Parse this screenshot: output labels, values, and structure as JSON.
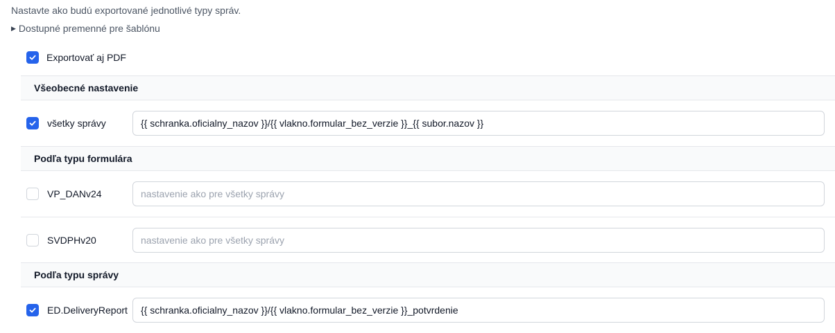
{
  "intro_text": "Nastavte ako budú exportované jednotlivé typy správ.",
  "details_label": "Dostupné premenné pre šablónu",
  "export_pdf": {
    "label": "Exportovať aj PDF",
    "checked": true
  },
  "sections": [
    {
      "title": "Všeobecné nastavenie",
      "rows": [
        {
          "label": "všetky správy",
          "checked": true,
          "value": "{{ schranka.oficialny_nazov }}/{{ vlakno.formular_bez_verzie }}_{{ subor.nazov }}",
          "placeholder": ""
        }
      ]
    },
    {
      "title": "Podľa typu formulára",
      "rows": [
        {
          "label": "VP_DANv24",
          "checked": false,
          "value": "",
          "placeholder": "nastavenie ako pre všetky správy"
        },
        {
          "label": "SVDPHv20",
          "checked": false,
          "value": "",
          "placeholder": "nastavenie ako pre všetky správy"
        }
      ]
    },
    {
      "title": "Podľa typu správy",
      "rows": [
        {
          "label": "ED.DeliveryReport",
          "checked": true,
          "value": "{{ schranka.oficialny_nazov }}/{{ vlakno.formular_bez_verzie }}_potvrdenie",
          "placeholder": ""
        }
      ]
    }
  ],
  "colors": {
    "accent": "#2563eb",
    "section_bg": "#f9fafb",
    "border": "#e5e7eb"
  }
}
